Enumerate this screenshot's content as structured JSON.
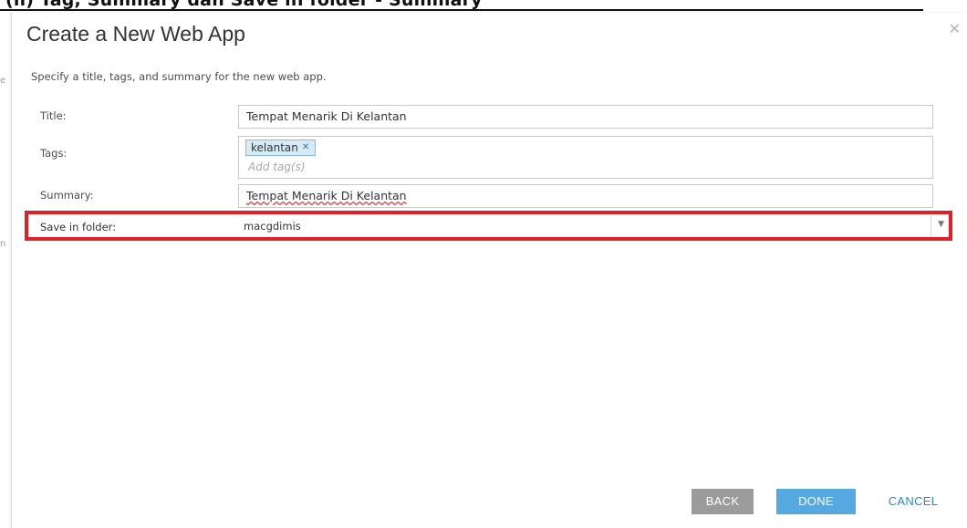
{
  "background_page": {
    "heading_fragment": "(ii) Tag, Summary dan Save in folder - Summary",
    "edge_glyphs": [
      "e",
      "n"
    ]
  },
  "dialog": {
    "title": "Create a New Web App",
    "close_icon": "close-icon",
    "description": "Specify a title, tags, and summary for the new web app.",
    "fields": {
      "title": {
        "label": "Title:",
        "value": "Tempat Menarik Di Kelantan"
      },
      "tags": {
        "label": "Tags:",
        "chips": [
          "kelantan"
        ],
        "placeholder": "Add tag(s)"
      },
      "summary": {
        "label": "Summary:",
        "value": "Tempat Menarik Di Kelantan"
      },
      "folder": {
        "label": "Save in folder:",
        "selected": "macgdimis",
        "icon": "chevron-down-icon"
      }
    },
    "highlight_color": "#e31e26",
    "buttons": {
      "back": "BACK",
      "done": "DONE",
      "cancel": "CANCEL"
    }
  },
  "colors": {
    "accent": "#56a9e0",
    "link": "#2b86c8",
    "disabled": "#9b9b9b"
  }
}
